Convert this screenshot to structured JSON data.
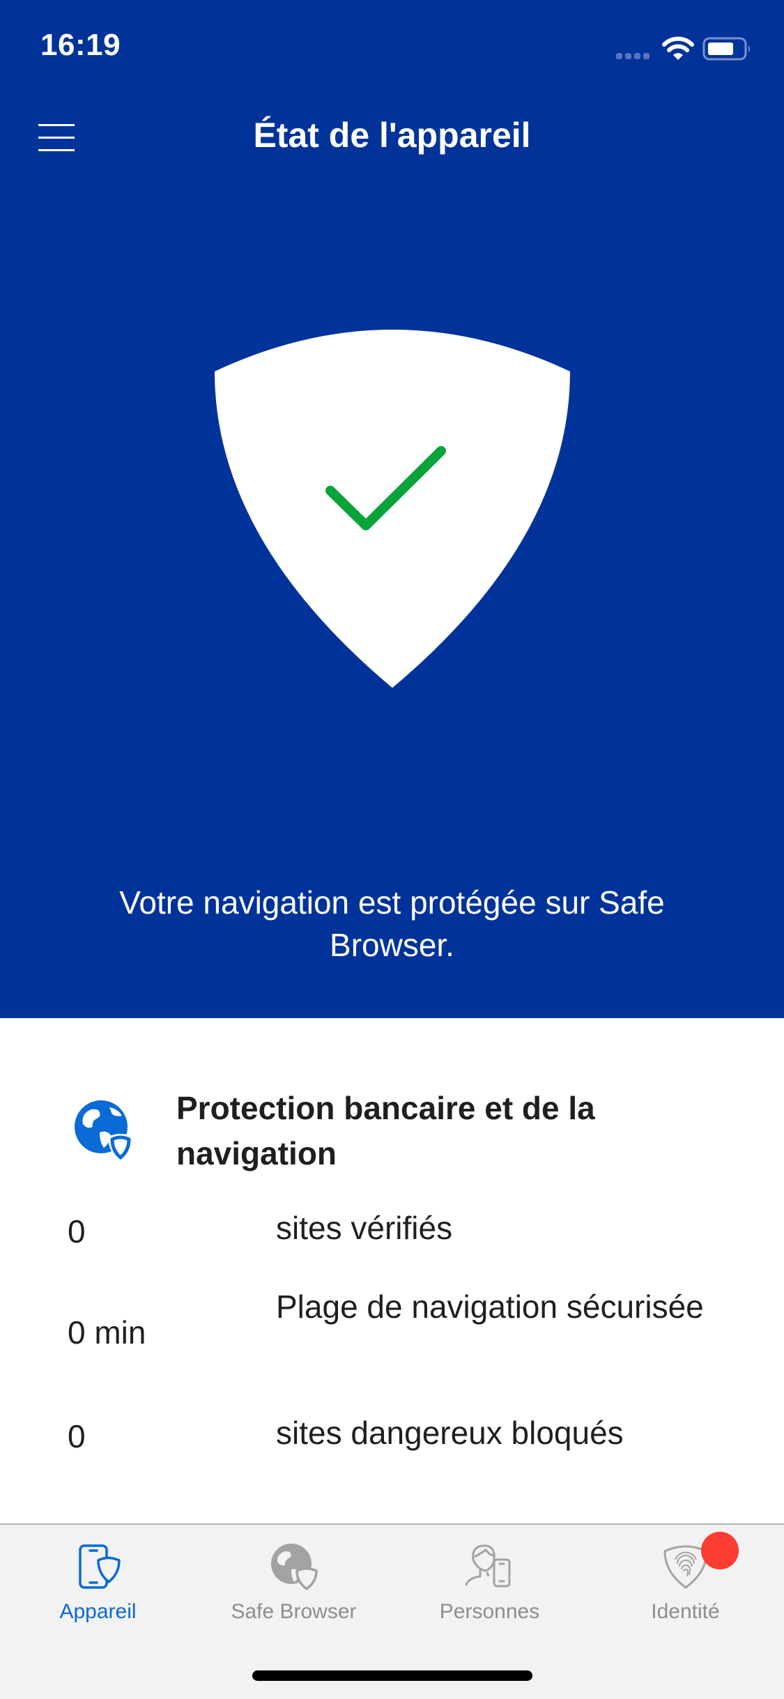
{
  "status_bar": {
    "time": "16:19",
    "signal_icon": "cellular-signal-icon",
    "wifi_icon": "wifi-icon",
    "battery_icon": "battery-icon"
  },
  "nav": {
    "title": "État de l'appareil",
    "menu_icon": "hamburger-menu-icon"
  },
  "hero": {
    "status_icon": "shield-check-icon",
    "message": "Votre navigation est protégée sur Safe Browser.",
    "colors": {
      "background": "#003399",
      "check": "#0aa33a"
    }
  },
  "card": {
    "icon": "globe-shield-icon",
    "title": "Protection bancaire et de la navigation",
    "stats": [
      {
        "value": "0",
        "label": "sites vérifiés"
      },
      {
        "value": "0 min",
        "label": "Plage de navigation sécurisée"
      },
      {
        "value": "0",
        "label": "sites dangereux bloqués"
      }
    ]
  },
  "tabbar": {
    "active_color": "#0a6ad6",
    "inactive_color": "#8e8e8e",
    "tabs": [
      {
        "label": "Appareil",
        "icon": "phone-shield-icon",
        "active": true
      },
      {
        "label": "Safe Browser",
        "icon": "globe-shield-icon",
        "active": false
      },
      {
        "label": "Personnes",
        "icon": "person-phone-icon",
        "active": false
      },
      {
        "label": "Identité",
        "icon": "fingerprint-shield-icon",
        "active": false,
        "badge": true,
        "badge_color": "#fc3d32"
      }
    ]
  }
}
